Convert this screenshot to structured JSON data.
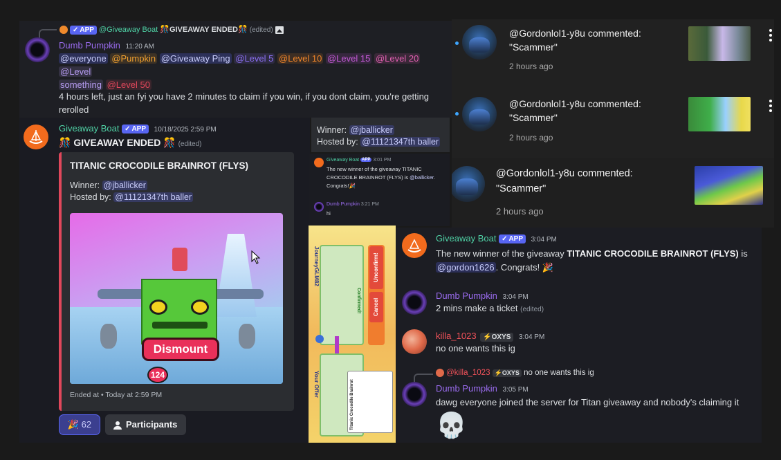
{
  "top_message": {
    "reply": {
      "author": "@Giveaway Boat",
      "badge": "APP",
      "text": "GIVEAWAY ENDED",
      "edited": "(edited)"
    },
    "author": "Dumb Pumpkin",
    "time": "11:20 AM",
    "mentions": [
      "@everyone",
      "@Pumpkin",
      "@Giveaway Ping",
      "@Level 5",
      "@Level 10",
      "@Level 15",
      "@Level 20",
      "@Level",
      "something",
      "@Level 50"
    ],
    "mention_colors": {
      "everyone": "#c9cdfb",
      "pumpkin": "#f0a030",
      "level5": "#8a6ff0",
      "level10": "#f0852a",
      "level15": "#c45ad6",
      "level20": "#e05fb0",
      "level": "#b59bf0",
      "level50": "#e0475b"
    },
    "body": "4 hours left, just an fyi you have 2 minutes to claim if you win, if you dont claim, you're getting rerolled"
  },
  "giveaway_message": {
    "author": "Giveaway Boat",
    "badge": "APP",
    "time": "10/18/2025 2:59 PM",
    "title_emoji": "🎊",
    "title": "GIVEAWAY ENDED",
    "edited": "(edited)",
    "embed": {
      "title": "TITANIC CROCODILE BRAINROT (FLYS)",
      "winner_label": "Winner:",
      "winner": "@jballicker",
      "hosted_label": "Hosted by:",
      "host": "@11121347th baller",
      "image_button": "Dismount",
      "image_badge": "124",
      "footer": "Ended at • Today at 2:59 PM"
    },
    "reaction_count": "62",
    "participants_label": "Participants"
  },
  "middle_crop": {
    "winner_label": "Winner:",
    "winner": "@jballicker",
    "hosted_label": "Hosted by:",
    "host": "@11121347th baller",
    "mini_author": "Giveaway Boat",
    "mini_badge": "APP",
    "mini_time": "3:01 PM",
    "mini_text": "The new winner of the giveaway TITANIC CROCODILE BRAINROT (FLYS) is",
    "mini_mention": "@ballicker",
    "mini_congrats": ". Congrats!",
    "mini_author2": "Dumb Pumpkin",
    "mini_time2": "3:21 PM",
    "mini_text2": "hi",
    "trade": {
      "player": "JourneyGLM82",
      "cancel": "Cancel",
      "unconfirm": "Unconfirm!",
      "confirmed": "Confirmed!",
      "item_title": "Titanic Crocodile Brainrot",
      "your_offer": "Your Offer"
    }
  },
  "yt_comments": [
    {
      "author": "@Gordonlol1-y8u",
      "action": "commented:",
      "text": "\"Scammer\"",
      "time": "2 hours ago"
    },
    {
      "author": "@Gordonlol1-y8u",
      "action": "commented:",
      "text": "\"Scammer\"",
      "time": "2 hours ago"
    },
    {
      "author": "@Gordonlol1-y8u",
      "action": "commented:",
      "text": "\"Scammer\"",
      "time": "2 hours ago"
    }
  ],
  "right_chat": {
    "m1": {
      "author": "Giveaway Boat",
      "badge": "APP",
      "time": "3:04 PM",
      "text_a": "The new winner of the giveaway ",
      "text_bold": "TITANIC CROCODILE BRAINROT (FLYS)",
      "text_b": " is",
      "mention": "@gordon1626",
      "text_c": ". Congrats!",
      "emoji": "🎉"
    },
    "m2": {
      "author": "Dumb Pumpkin",
      "time": "3:04 PM",
      "text": "2 mins make a ticket",
      "edited": "(edited)"
    },
    "m3": {
      "author": "killa_1023",
      "tag": "OXYS",
      "time": "3:04 PM",
      "text": "no one wants this ig"
    },
    "m4": {
      "reply_author": "@killa_1023",
      "reply_tag": "OXYS",
      "reply_text": "no one wants this ig",
      "author": "Dumb Pumpkin",
      "time": "3:05 PM",
      "text": "dawg everyone joined the server for Titan giveaway and nobody's claiming it",
      "emoji": "💀"
    }
  },
  "colors": {
    "discord_bg": "#1e1f22",
    "discord_bg2": "#1a1b1f",
    "embed_bg": "#2b2d31",
    "embed_border": "#e0475b",
    "yt_bg": "#212121",
    "pumpkin_name": "#9b6cf0",
    "boat_name": "#4fd1a5",
    "killa_name": "#f2525a",
    "link": "#c9cdfb"
  }
}
